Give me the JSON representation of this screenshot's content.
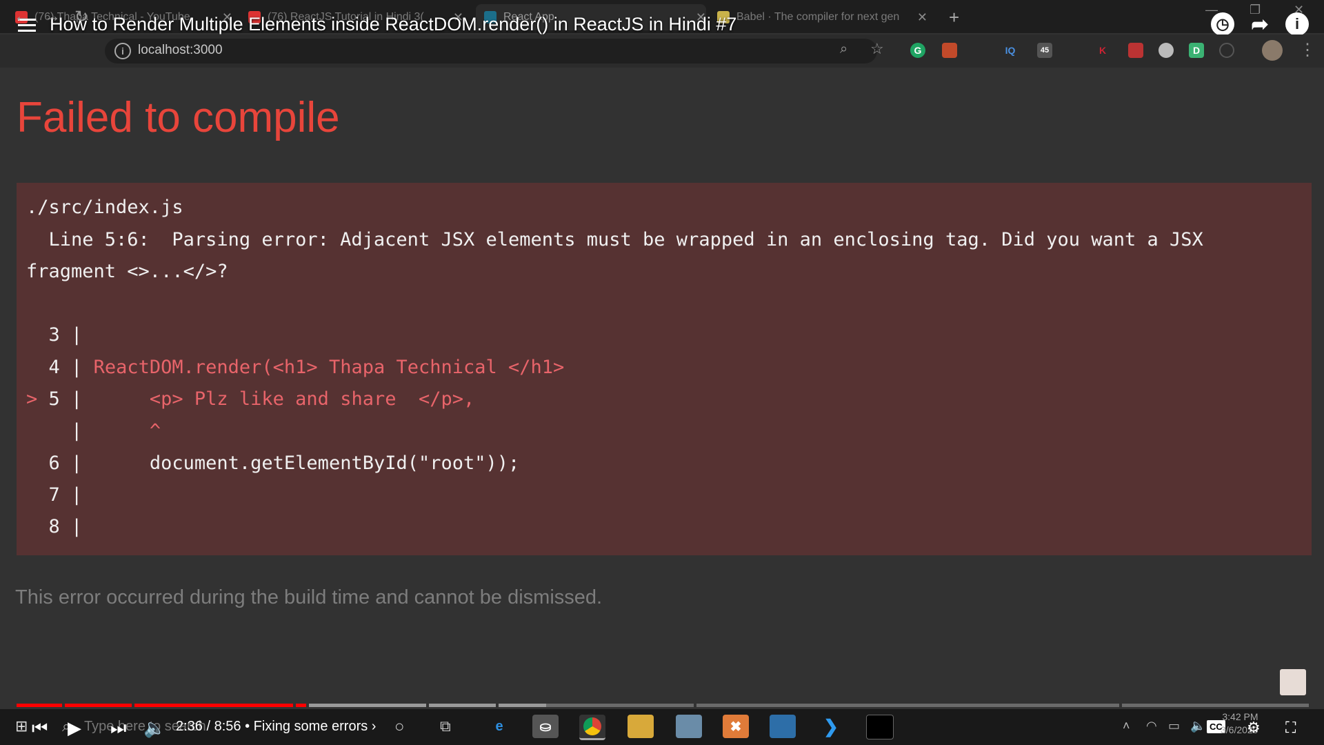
{
  "browser": {
    "tabs": [
      {
        "label": "(76) Thapa Technical - YouTube",
        "favicon_color": "#d33"
      },
      {
        "label": "(76) ReactJS Tutorial in Hindi 3(",
        "favicon_color": "#d33"
      },
      {
        "label": "React App",
        "favicon_color": "#1b6e8a"
      },
      {
        "label": "Babel · The compiler for next gen",
        "favicon_color": "#c9b24a"
      }
    ],
    "url": "localhost:3000",
    "download_badge": "45"
  },
  "youtube": {
    "video_title": "How to Render Multiple Elements inside ReactDOM.render() in ReactJS in Hindi #7",
    "time_display": "2:36 / 8:56",
    "chapter": "• Fixing some errors ›",
    "progress_fraction": 0.225,
    "buffer_fraction": 0.41,
    "chapter_marks": [
      0.035,
      0.089,
      0.214,
      0.224,
      0.317,
      0.371,
      0.524,
      0.853
    ],
    "cc_label": "CC"
  },
  "error_page": {
    "title": "Failed to compile",
    "file": "./src/index.js",
    "message_line1": "  Line 5:6:  Parsing error: Adjacent JSX elements must be wrapped in an enclosing tag. Did you want a JSX",
    "message_line2": "fragment <>...</>?",
    "code_lines": [
      {
        "marker": " ",
        "num": "3",
        "code": ""
      },
      {
        "marker": " ",
        "num": "4",
        "code": "ReactDOM.render(<h1> Thapa Technical </h1>"
      },
      {
        "marker": ">",
        "num": "5",
        "code": "     <p> Plz like and share  </p>,"
      },
      {
        "marker": " ",
        "num": " ",
        "code": "     ^"
      },
      {
        "marker": " ",
        "num": "6",
        "code": "     document.getElementById(\"root\"));"
      },
      {
        "marker": " ",
        "num": "7",
        "code": ""
      },
      {
        "marker": " ",
        "num": "8",
        "code": ""
      }
    ],
    "footer": "This error occurred during the build time and cannot be dismissed."
  },
  "taskbar": {
    "search_placeholder": "Type here to search",
    "clock_time": "3:42 PM",
    "clock_date": "3/6/2020"
  }
}
